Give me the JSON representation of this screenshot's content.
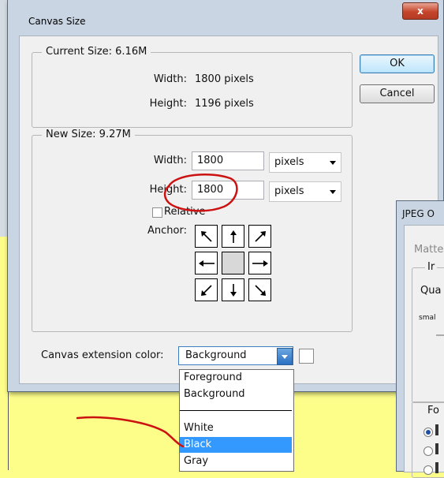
{
  "dialog": {
    "title": "Canvas Size",
    "close_glyph": "x",
    "current_size": {
      "legend": "Current Size: 6.16M",
      "width_label": "Width:",
      "width_value": "1800 pixels",
      "height_label": "Height:",
      "height_value": "1196 pixels"
    },
    "buttons": {
      "ok": "OK",
      "cancel": "Cancel"
    },
    "new_size": {
      "legend": "New Size: 9.27M",
      "width_label": "Width:",
      "width_value": "1800",
      "width_unit": "pixels",
      "height_label": "Height:",
      "height_value": "1800",
      "height_unit": "pixels",
      "relative_label": "Relative",
      "anchor_label": "Anchor:"
    },
    "extension_color": {
      "label": "Canvas extension color:",
      "value": "Background",
      "options": [
        "Foreground",
        "Background",
        "White",
        "Black",
        "Gray"
      ],
      "highlighted": "Black"
    }
  },
  "jpeg_window": {
    "title": "JPEG O",
    "matte_label": "Matte",
    "group_label": "Ir",
    "quality_label": "Qua",
    "small_label": "smal",
    "format_label": "Fo"
  },
  "annotations": {
    "color": "#cc1111"
  }
}
